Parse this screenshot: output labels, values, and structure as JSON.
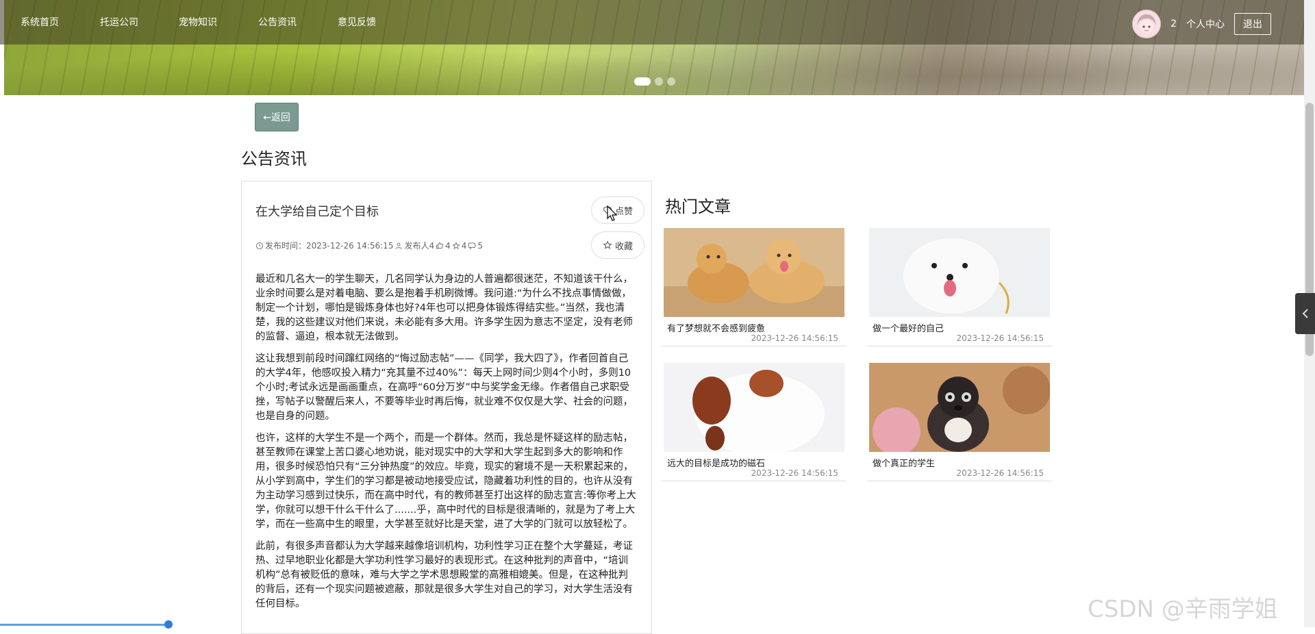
{
  "nav": {
    "items": [
      "系统首页",
      "托运公司",
      "宠物知识",
      "公告资讯",
      "意见反馈"
    ],
    "user_count": "2",
    "user_center": "个人中心",
    "logout": "退出"
  },
  "back_label": "←返回",
  "page_title": "公告资讯",
  "article": {
    "title": "在大学给自己定个目标",
    "meta": {
      "time_label": "发布时间：2023-12-26 14:56:15",
      "author": "发布人4",
      "likes": "4",
      "favorites": "4",
      "comments": "5"
    },
    "like_label": "点赞",
    "fav_label": "收藏",
    "paragraphs": [
      "最近和几名大一的学生聊天，几名同学认为身边的人普遍都很迷茫，不知道该干什么，业余时间要么是对着电脑、要么是抱着手机刷微博。我问道:“为什么不找点事情做做，制定一个计划，哪怕是锻炼身体也好?4年也可以把身体锻炼得结实些。”当然，我也清楚，我的这些建议对他们来说，未必能有多大用。许多学生因为意志不坚定，没有老师的监督、逼迫，根本就无法做到。",
      "这让我想到前段时间蹿红网络的“悔过励志帖”——《同学，我大四了》，作者回首自己的大学4年，他感叹投入精力“充其量不过40%”：每天上网时间少则4个小时，多则10个小时;考试永远是画画重点，在高呼“60分万岁”中与奖学金无缘。作者借自己求职受挫，写帖子以警醒后来人，不要等毕业时再后悔，就业难不仅仅是大学、社会的问题，也是自身的问题。",
      "也许，这样的大学生不是一个两个，而是一个群体。然而，我总是怀疑这样的励志帖，甚至教师在课堂上苦口婆心地劝说，能对现实中的大学和大学生起到多大的影响和作用，很多时候恐怕只有“三分钟热度”的效应。毕竟，现实的窘境不是一天积累起来的，从小学到高中，学生们的学习都是被动地接受应试，隐藏着功利性的目的，也许从没有为主动学习感到过快乐，而在高中时代，有的教师甚至打出这样的励志宣言:等你考上大学，你就可以想干什么干什么了.......乎，高中时代的目标是很清晰的，就是为了考上大学，而在一些高中生的眼里，大学甚至就好比是天堂，进了大学的门就可以放轻松了。",
      "此前，有很多声音都认为大学越来越像培训机构，功利性学习正在整个大学蔓延，考证热、过早地职业化都是大学功利性学习最好的表现形式。在这种批判的声音中，“培训机构”总有被贬低的意味，难与大学之学术思想殿堂的高雅相媲美。但是，在这种批判的背后，还有一个现实问题被遮蔽，那就是很多大学生对自己的学习，对大学生活没有任何目标。"
    ]
  },
  "hot": {
    "title": "热门文章",
    "cards": [
      {
        "caption": "有了梦想就不会感到疲惫",
        "date": "2023-12-26 14:56:15"
      },
      {
        "caption": "做一个最好的自己",
        "date": "2023-12-26 14:56:15"
      },
      {
        "caption": "远大的目标是成功的磁石",
        "date": "2023-12-26 14:56:15"
      },
      {
        "caption": "做个真正的学生",
        "date": "2023-12-26 14:56:15"
      }
    ]
  },
  "watermark": "CSDN @辛雨学姐",
  "colors": {
    "accent_button": "#7a9a92",
    "nav_overlay": "#3c3723",
    "progress": "#2f7ed8"
  },
  "icons": [
    "clock-icon",
    "user-icon",
    "thumb-icon",
    "star-icon",
    "comment-icon",
    "heart-icon",
    "chevron-left-icon"
  ],
  "carousel": {
    "slides": 3,
    "active": 1
  }
}
